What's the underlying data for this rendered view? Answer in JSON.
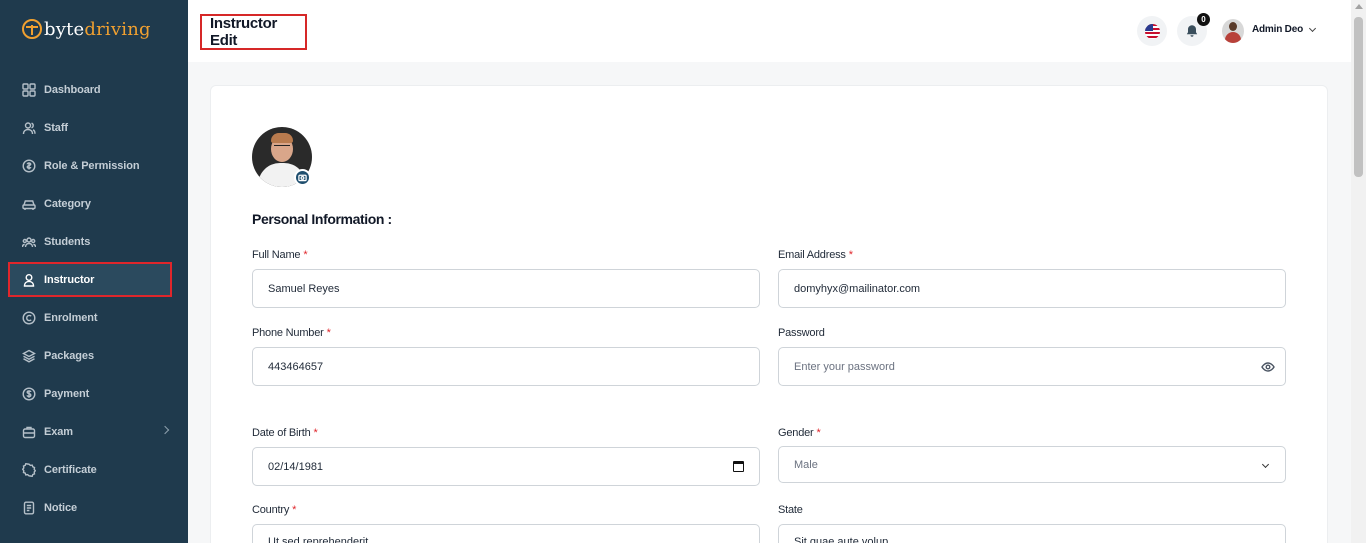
{
  "brand": {
    "logo_prefix": "byte",
    "logo_suffix": "driving"
  },
  "sidebar": {
    "items": [
      {
        "label": "Dashboard",
        "icon": "grid-icon"
      },
      {
        "label": "Staff",
        "icon": "users-icon"
      },
      {
        "label": "Role & Permission",
        "icon": "shield-icon"
      },
      {
        "label": "Category",
        "icon": "car-icon"
      },
      {
        "label": "Students",
        "icon": "group-icon"
      },
      {
        "label": "Instructor",
        "icon": "user-icon",
        "active": true
      },
      {
        "label": "Enrolment",
        "icon": "badge-icon"
      },
      {
        "label": "Packages",
        "icon": "layers-icon"
      },
      {
        "label": "Payment",
        "icon": "dollar-icon"
      },
      {
        "label": "Exam",
        "icon": "briefcase-icon",
        "has_submenu": true
      },
      {
        "label": "Certificate",
        "icon": "certificate-icon"
      },
      {
        "label": "Notice",
        "icon": "document-icon"
      }
    ]
  },
  "header": {
    "title": "Instructor Edit",
    "notification_count": "0",
    "user_name": "Admin Deo",
    "language_icon": "us-flag-icon"
  },
  "form": {
    "section_title": "Personal Information :",
    "full_name": {
      "label": "Full Name",
      "value": "Samuel Reyes",
      "required": "*"
    },
    "email": {
      "label": "Email Address",
      "value": "domyhyx@mailinator.com",
      "required": "*"
    },
    "phone": {
      "label": "Phone Number",
      "value": "443464657",
      "required": "*"
    },
    "password": {
      "label": "Password",
      "placeholder": "Enter your password"
    },
    "dob": {
      "label": "Date of Birth",
      "value": "02/14/1981",
      "required": "*"
    },
    "gender": {
      "label": "Gender",
      "value": "Male",
      "required": "*"
    },
    "country": {
      "label": "Country",
      "value": "Ut sed reprehenderit",
      "required": "*"
    },
    "state": {
      "label": "State",
      "value": "Sit quae aute volup"
    }
  },
  "colors": {
    "sidebar_bg": "#1f3a4d",
    "accent": "#f0a030",
    "highlight_border": "#e0262b",
    "required": "#e0262b"
  }
}
